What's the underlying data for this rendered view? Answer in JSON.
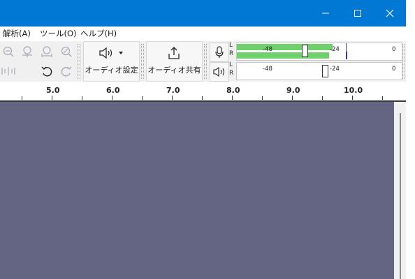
{
  "window": {
    "controls": [
      "minimize-icon",
      "maximize-icon",
      "close-icon"
    ],
    "accent": "#0078d4"
  },
  "menu": {
    "analyze": "解析(A)",
    "tools": "ツール(O)",
    "help": "ヘルプ(H)"
  },
  "toolbar": {
    "audio_setup_label": "オーディオ設定",
    "share_audio_label": "オーディオ共有",
    "icons": [
      "zoom-out-icon",
      "fit-selection-icon",
      "fit-project-icon",
      "zoom-toggle-icon",
      "trim-icon",
      "undo-icon",
      "redo-icon",
      "speaker-icon",
      "share-icon",
      "microphone-icon",
      "playback-speaker-icon"
    ]
  },
  "meters": {
    "record": {
      "channel_l": "L",
      "channel_r": "R",
      "tick_48": "-48",
      "tick_24": "-24",
      "tick_0": "0",
      "level_l": 0.58,
      "level_r": 0.56
    },
    "playback": {
      "channel_l": "L",
      "channel_r": "R",
      "tick_48": "-48",
      "tick_24": "-24",
      "tick_0": "0"
    },
    "level_color": "#6fd16b"
  },
  "ruler": {
    "labels": [
      "5.0",
      "6.0",
      "7.0",
      "8.0",
      "9.0",
      "10.0"
    ]
  },
  "track": {
    "background": "#646483"
  }
}
